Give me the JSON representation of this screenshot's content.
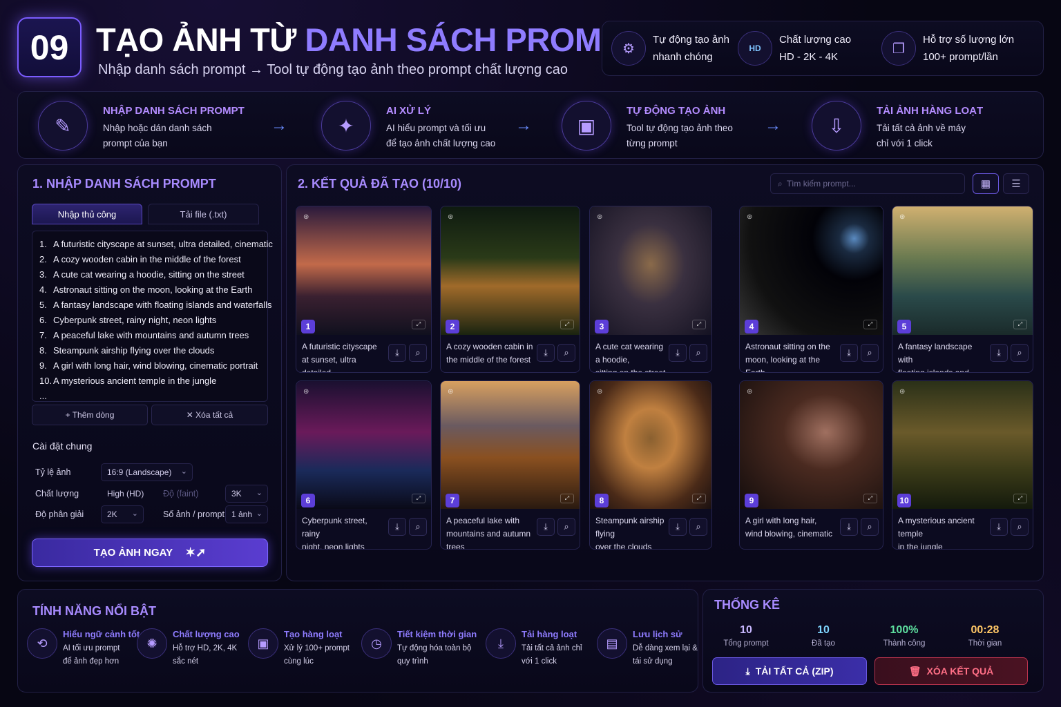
{
  "header": {
    "badge": "09",
    "title_white": "TẠO ẢNH TỪ ",
    "title_purple": "DANH SÁCH PROMPT",
    "subtitle": "Nhập danh sách prompt → Tool tự động tạo ảnh theo prompt chất lượng cao",
    "features": [
      {
        "icon": "gear-auto-icon",
        "line1": "Tự động tạo ảnh",
        "line2": "nhanh chóng"
      },
      {
        "icon": "hd-icon",
        "line1": "Chất lượng cao",
        "line2": "HD - 2K - 4K"
      },
      {
        "icon": "stack-icon",
        "line1": "Hỗ trợ số lượng lớn",
        "line2": "100+ prompt/lần"
      }
    ]
  },
  "steps": [
    {
      "icon": "edit-list-icon",
      "title": "NHẬP DANH SÁCH PROMPT",
      "line1": "Nhập hoặc dán danh sách",
      "line2": "prompt của bạn"
    },
    {
      "icon": "ai-brain-icon",
      "title": "AI XỬ LÝ",
      "line1": "AI hiểu prompt và tối ưu",
      "line2": "để tạo ảnh chất lượng cao"
    },
    {
      "icon": "auto-image-icon",
      "title": "TỰ ĐỘNG TẠO ẢNH",
      "line1": "Tool tự động tạo ảnh theo",
      "line2": "từng prompt"
    },
    {
      "icon": "batch-download-icon",
      "title": "TẢI ẢNH HÀNG LOẠT",
      "line1": "Tải tất cả ảnh về máy",
      "line2": "chỉ với 1 click"
    }
  ],
  "input_panel": {
    "title": "1. NHẬP DANH SÁCH PROMPT",
    "tab_manual": "Nhập thủ công",
    "tab_file": "Tải file (.txt)",
    "prompts": [
      "A futuristic cityscape at sunset, ultra detailed, cinematic",
      "A cozy wooden cabin in the middle of the forest",
      "A cute cat wearing a hoodie, sitting on the street",
      "Astronaut sitting on the moon, looking at the Earth",
      "A fantasy landscape with floating islands and waterfalls",
      "Cyberpunk street, rainy night, neon lights",
      "A peaceful lake with mountains and autumn trees",
      "Steampunk airship flying over the clouds",
      "A girl with long hair, wind blowing, cinematic portrait",
      "A mysterious ancient temple in the jungle"
    ],
    "ellipsis": "...",
    "add_row": "+ Thêm dòng",
    "clear_all": "✕ Xóa tất cả",
    "settings_title": "Cài đặt chung",
    "aspect_label": "Tỷ lệ ảnh",
    "aspect_value": "16:9 (Landscape)",
    "quality_label": "Chất lượng",
    "quality_value": "High (HD)",
    "quality_extra_label": "Độ (faint)",
    "quality_extra_value": "3K",
    "resolution_label": "Độ phân giải",
    "resolution_value": "2K",
    "per_prompt_label": "Số ảnh / prompt",
    "per_prompt_value": "1 ảnh",
    "generate_button": "TẠO ẢNH NGAY"
  },
  "results": {
    "title": "2. KẾT QUẢ ĐÃ TẠO (10/10)",
    "search_placeholder": "Tìm kiếm prompt...",
    "cards": [
      {
        "num": "1",
        "cap1": "A futuristic cityscape",
        "cap2": "at sunset, ultra detailed"
      },
      {
        "num": "2",
        "cap1": "A cozy wooden cabin in",
        "cap2": "the middle of the forest"
      },
      {
        "num": "3",
        "cap1": "A cute cat wearing a hoodie,",
        "cap2": "sitting on the street"
      },
      {
        "num": "4",
        "cap1": "Astronaut sitting on the",
        "cap2": "moon, looking at the Earth"
      },
      {
        "num": "5",
        "cap1": "A fantasy landscape with",
        "cap2": "floating islands and waterfalls"
      },
      {
        "num": "6",
        "cap1": "Cyberpunk street, rainy",
        "cap2": "night, neon lights"
      },
      {
        "num": "7",
        "cap1": "A peaceful lake with",
        "cap2": "mountains and autumn trees"
      },
      {
        "num": "8",
        "cap1": "Steampunk airship flying",
        "cap2": "over the clouds"
      },
      {
        "num": "9",
        "cap1": "A girl with long hair,",
        "cap2": "wind blowing, cinematic"
      },
      {
        "num": "10",
        "cap1": "A mysterious ancient temple",
        "cap2": "in the jungle"
      }
    ]
  },
  "features": {
    "title": "TÍNH NĂNG NỔI BẬT",
    "items": [
      {
        "icon": "language-icon",
        "title": "Hiểu ngữ cảnh tốt",
        "line1": "AI tối ưu prompt",
        "line2": "để ảnh đẹp hơn"
      },
      {
        "icon": "quality-icon",
        "title": "Chất lượng cao",
        "line1": "Hỗ trợ HD, 2K, 4K",
        "line2": "sắc nét"
      },
      {
        "icon": "batch-icon",
        "title": "Tạo hàng loạt",
        "line1": "Xử lý 100+ prompt",
        "line2": "cùng lúc"
      },
      {
        "icon": "time-icon",
        "title": "Tiết kiệm thời gian",
        "line1": "Tự động hóa toàn bộ",
        "line2": "quy trình"
      },
      {
        "icon": "download-icon",
        "title": "Tải hàng loạt",
        "line1": "Tải tất cả ảnh chỉ",
        "line2": "với 1 click"
      },
      {
        "icon": "history-icon",
        "title": "Lưu lịch sử",
        "line1": "Dễ dàng xem lại &",
        "line2": "tái sử dụng"
      }
    ]
  },
  "stats": {
    "title": "THỐNG KÊ",
    "items": [
      {
        "value": "10",
        "label": "Tổng prompt",
        "color": "#c8b8ff"
      },
      {
        "value": "10",
        "label": "Đã tạo",
        "color": "#7fd6ff"
      },
      {
        "value": "100%",
        "label": "Thành công",
        "color": "#5ee0a0"
      },
      {
        "value": "00:28",
        "label": "Thời gian",
        "color": "#ffc766"
      }
    ],
    "download_zip": "TẢI TẤT CẢ (ZIP)",
    "clear_results": "XÓA KẾT QUẢ"
  },
  "colors": {
    "accent": "#8f7cff",
    "brand": "#5c3ed8",
    "danger": "#ff6f86"
  }
}
